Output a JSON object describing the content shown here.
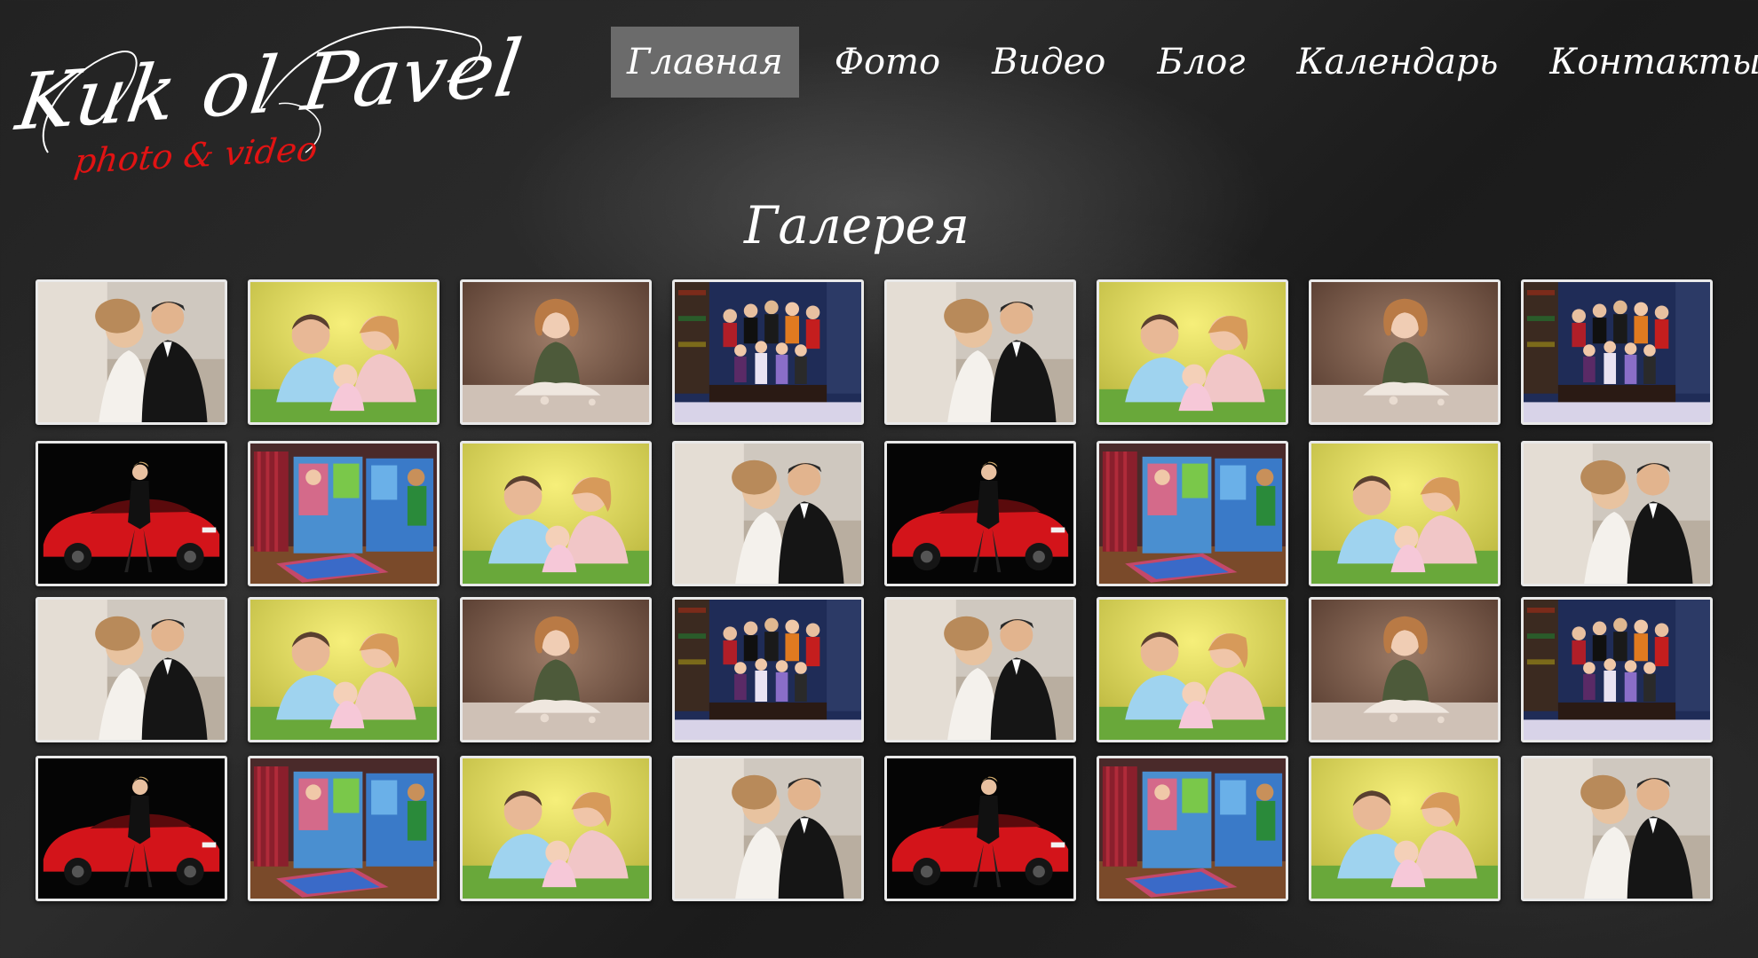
{
  "logo": {
    "name": "Kuk ol Pavel",
    "tagline": "photo & video"
  },
  "nav": {
    "items": [
      {
        "label": "Главная",
        "active": true
      },
      {
        "label": "Фото",
        "active": false
      },
      {
        "label": "Видео",
        "active": false
      },
      {
        "label": "Блог",
        "active": false
      },
      {
        "label": "Календарь",
        "active": false
      },
      {
        "label": "Контакты",
        "active": false
      }
    ]
  },
  "gallery": {
    "title": "Галерея",
    "rows": [
      [
        "wedding-couple",
        "family-yellow",
        "girl-sitting",
        "group-library",
        "wedding-couple",
        "family-yellow",
        "girl-sitting",
        "group-library"
      ],
      [
        "red-car-woman",
        "photobook",
        "family-yellow",
        "wedding-couple",
        "red-car-woman",
        "photobook",
        "family-yellow",
        "wedding-couple"
      ],
      [
        "wedding-couple",
        "family-yellow",
        "girl-sitting",
        "group-library",
        "wedding-couple",
        "family-yellow",
        "girl-sitting",
        "group-library"
      ],
      [
        "red-car-woman",
        "photobook",
        "family-yellow",
        "wedding-couple",
        "red-car-woman",
        "photobook",
        "family-yellow",
        "wedding-couple"
      ]
    ]
  },
  "colors": {
    "background": "#1a1a1a",
    "nav_active": "#6b6b6b",
    "text": "#ffffff",
    "tagline": "#e11313",
    "thumb_border": "#e9e9e9"
  }
}
